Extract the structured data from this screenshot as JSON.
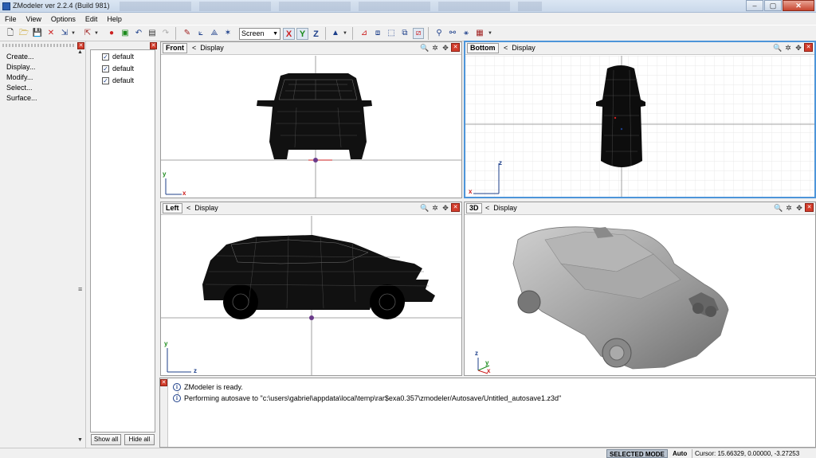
{
  "window": {
    "title": "ZModeler ver 2.2.4 (Build 981)",
    "buttons": {
      "minimize": "–",
      "maximize": "▢",
      "close": "✕"
    }
  },
  "menu": [
    "File",
    "View",
    "Options",
    "Edit",
    "Help"
  ],
  "toolbar": {
    "coord_mode": "Screen",
    "axis_x": "X",
    "axis_y": "Y",
    "axis_z": "Z"
  },
  "commands": [
    "Create...",
    "Display...",
    "Modify...",
    "Select...",
    "Surface..."
  ],
  "objects": {
    "items": [
      "default",
      "default",
      "default"
    ],
    "show_all": "Show all",
    "hide_all": "Hide all"
  },
  "viewports": {
    "display_label": "Display",
    "front": {
      "name": "Front",
      "axis_v": "y",
      "axis_h": "x"
    },
    "bottom": {
      "name": "Bottom",
      "axis_v": "z",
      "axis_h": "x"
    },
    "left": {
      "name": "Left",
      "axis_v": "y",
      "axis_h": "z"
    },
    "view3d": {
      "name": "3D",
      "axis_v": "z",
      "axis_a": "y",
      "axis_b": "x"
    }
  },
  "log": [
    "ZModeler is ready.",
    "Performing autosave to \"c:\\users\\gabriel\\appdata\\local\\temp\\rar$exa0.357\\zmodeler/Autosave/Untitled_autosave1.z3d\""
  ],
  "status": {
    "mode": "SELECTED MODE",
    "auto": "Auto",
    "cursor": "Cursor: 15.66329, 0.00000, -3.27253"
  },
  "colors": {
    "active_viewport": "#4d95d9",
    "close_red": "#d23c2b",
    "axis_red": "#cc2020",
    "axis_green": "#1b8a1b",
    "axis_blue": "#1d3f8a"
  }
}
